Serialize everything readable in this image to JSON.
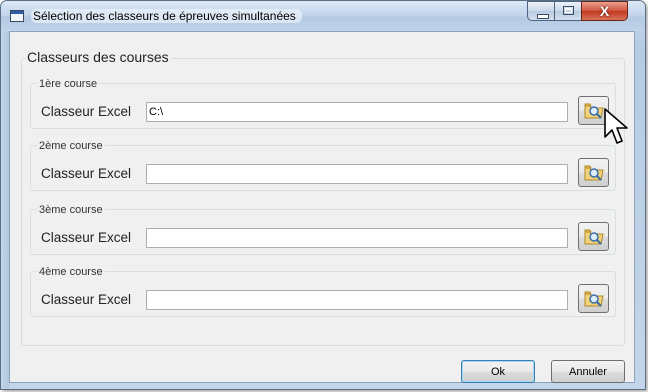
{
  "window": {
    "title": "Sélection des classeurs de épreuves simultanées",
    "close_symbol": "X",
    "icons": {
      "app": "window-app-icon",
      "minimize": "minimize-icon",
      "maximize": "maximize-icon",
      "close": "close-icon"
    }
  },
  "main_group": {
    "label": "Classeurs des courses"
  },
  "courses": [
    {
      "label": "1ère course",
      "field_label": "Classeur Excel",
      "value": "C:\\",
      "browse_icon": "folder-search-icon"
    },
    {
      "label": "2ème course",
      "field_label": "Classeur Excel",
      "value": "",
      "browse_icon": "folder-search-icon"
    },
    {
      "label": "3ème course",
      "field_label": "Classeur Excel",
      "value": "",
      "browse_icon": "folder-search-icon"
    },
    {
      "label": "4ème course",
      "field_label": "Classeur Excel",
      "value": "",
      "browse_icon": "folder-search-icon"
    }
  ],
  "buttons": {
    "ok": "Ok",
    "cancel": "Annuler"
  },
  "colors": {
    "close_button": "#c0391f",
    "default_button_border": "#3c7fb1",
    "client_bg": "#f0f0f0"
  }
}
